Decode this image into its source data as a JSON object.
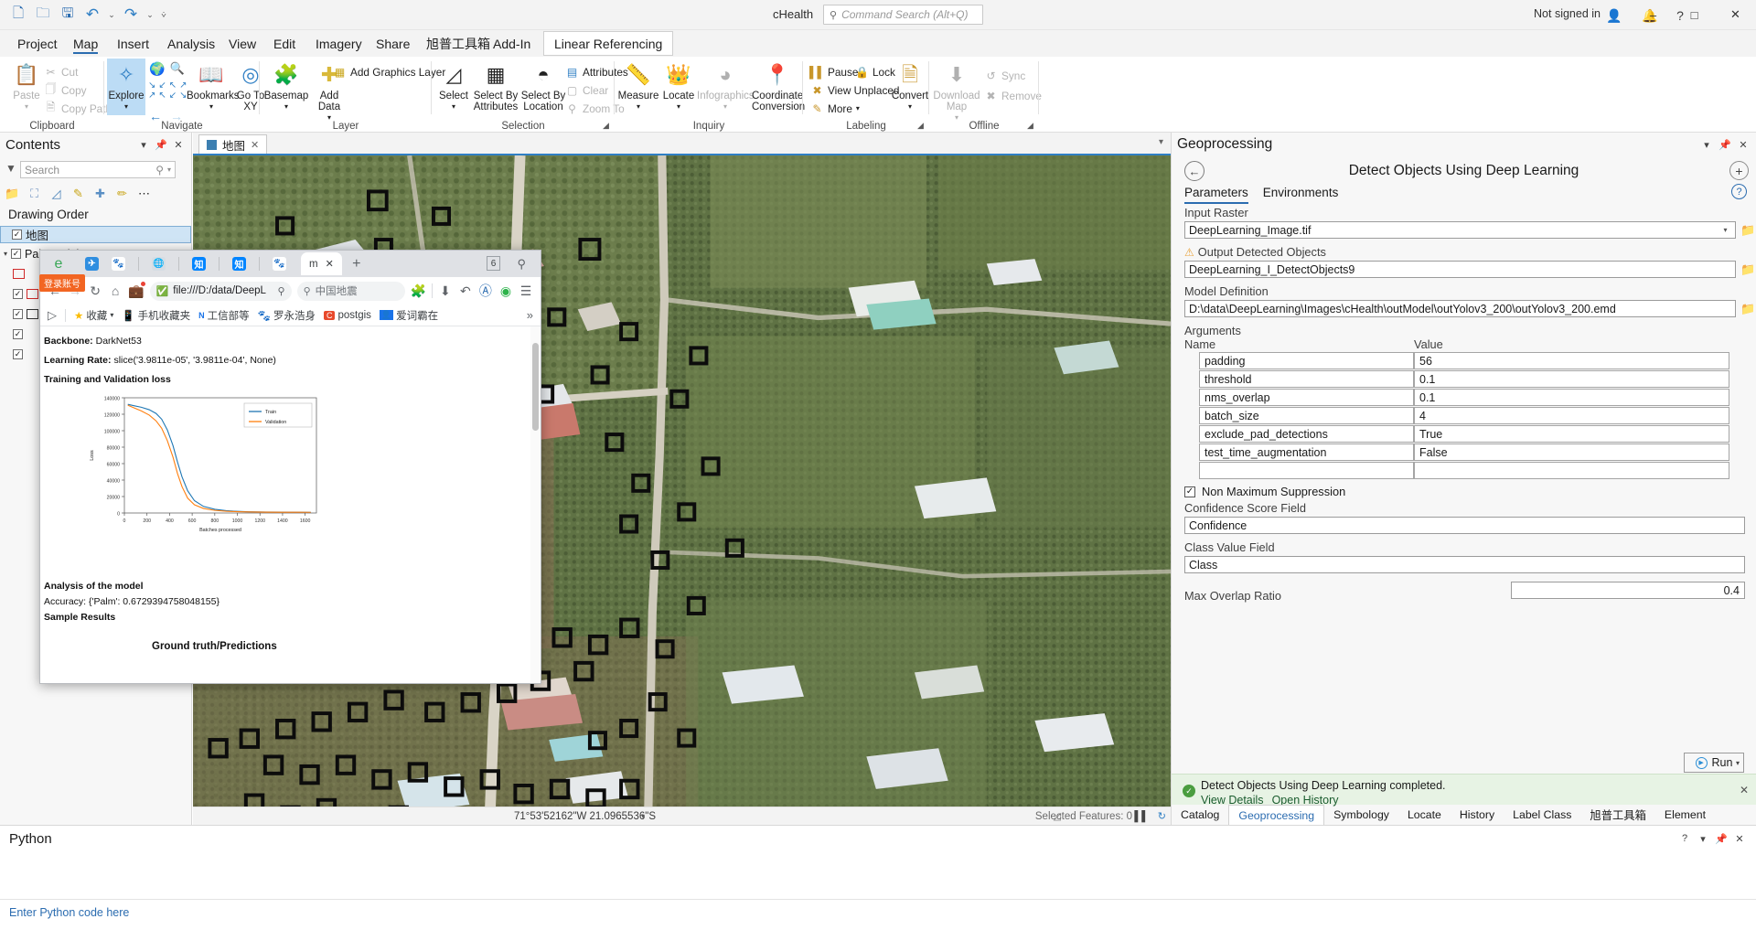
{
  "titlebar": {
    "project_name": "cHealth",
    "search_placeholder": "Command Search (Alt+Q)",
    "signin": "Not signed in",
    "quick_access": [
      "new-project-icon",
      "open-project-icon",
      "save-project-icon",
      "undo-icon",
      "redo-icon",
      "customize-qat-icon"
    ],
    "window_buttons": [
      "minimize",
      "restore",
      "close"
    ]
  },
  "ribbon": {
    "tabs": [
      {
        "label": "Project",
        "active": false
      },
      {
        "label": "Map",
        "active": true
      },
      {
        "label": "Insert",
        "active": false
      },
      {
        "label": "Analysis",
        "active": false
      },
      {
        "label": "View",
        "active": false
      },
      {
        "label": "Edit",
        "active": false
      },
      {
        "label": "Imagery",
        "active": false
      },
      {
        "label": "Share",
        "active": false
      },
      {
        "label": "旭普工具箱",
        "active": false
      },
      {
        "label": "Add-In",
        "active": false
      },
      {
        "label": "Linear Referencing",
        "active": false,
        "boxed": true
      }
    ],
    "groups": [
      {
        "name": "Clipboard"
      },
      {
        "name": "Navigate"
      },
      {
        "name": "Layer"
      },
      {
        "name": "Selection"
      },
      {
        "name": "Inquiry"
      },
      {
        "name": "Labeling"
      },
      {
        "name": "Offline"
      }
    ],
    "clipboard": {
      "paste": "Paste",
      "cut": "Cut",
      "copy": "Copy",
      "copy_path": "Copy Path"
    },
    "navigate": {
      "explore": "Explore",
      "bookmarks": "Bookmarks",
      "goto": "Go To XY"
    },
    "layer": {
      "basemap": "Basemap",
      "add_data": "Add Data",
      "add_graphics": "Add Graphics Layer"
    },
    "selection": {
      "select": "Select",
      "select_attr": "Select By Attributes",
      "select_loc": "Select By Location",
      "attributes": "Attributes",
      "clear": "Clear",
      "zoom_to": "Zoom To"
    },
    "inquiry": {
      "measure": "Measure",
      "locate": "Locate",
      "infographics": "Infographics",
      "coordinate": "Coordinate Conversion"
    },
    "labeling": {
      "pause": "Pause",
      "lock": "Lock",
      "view_unplaced": "View Unplaced",
      "more": "More",
      "convert": "Convert"
    },
    "offline": {
      "download_map": "Download Map",
      "sync": "Sync",
      "remove": "Remove"
    }
  },
  "contents": {
    "title": "Contents",
    "search_placeholder": "Search",
    "drawing_order": "Drawing Order",
    "layers": [
      {
        "label": "地图",
        "type": "map",
        "checked": true,
        "selected": true
      },
      {
        "label": "PalmTraining",
        "type": "group",
        "checked": true,
        "selected": false
      }
    ]
  },
  "map": {
    "tab_label": "地图",
    "tab_sublabel": "m",
    "coordinates": "71°53'52162\"W 21.0965536\"S",
    "selected_features": "Selected Features: 0"
  },
  "browser": {
    "tab_label": "m",
    "tab_count": "6",
    "url": "file:///D:/data/DeepL",
    "search_placeholder": "中国地震",
    "login_badge": "登录账号",
    "bookmarks": [
      "收藏",
      "手机收藏夹",
      "工信部等",
      "罗永浩身",
      "postgis",
      "爱词霸在"
    ],
    "page": {
      "backbone_label": "Backbone:",
      "backbone_value": "DarkNet53",
      "lr_label": "Learning Rate:",
      "lr_value": "slice('3.9811e-05', '3.9811e-04', None)",
      "loss_heading": "Training and Validation loss",
      "analysis_heading": "Analysis of the model",
      "accuracy": "Accuracy: {'Palm': 0.6729394758048155}",
      "sample_heading": "Sample Results",
      "gt_heading": "Ground truth/Predictions"
    }
  },
  "chart_data": {
    "type": "line",
    "title": "Training and Validation loss",
    "xlabel": "Batches processed",
    "ylabel": "Loss",
    "xlim": [
      0,
      1700
    ],
    "ylim": [
      0,
      140000
    ],
    "xticks": [
      0,
      200,
      400,
      600,
      800,
      1000,
      1200,
      1400,
      1600
    ],
    "yticks": [
      0,
      20000,
      40000,
      60000,
      80000,
      100000,
      120000,
      140000
    ],
    "ytick_labels": [
      "0",
      "20000",
      "40000",
      "60000",
      "80000",
      "100000",
      "120000",
      "140000"
    ],
    "legend": [
      "Train",
      "Validation"
    ],
    "legend_position": "upper right",
    "grid": false,
    "series": [
      {
        "name": "Train",
        "color": "#1f77b4",
        "x": [
          30,
          80,
          150,
          220,
          280,
          330,
          380,
          430,
          470,
          510,
          560,
          620,
          700,
          800,
          900,
          1000,
          1100,
          1250,
          1400,
          1550,
          1650
        ],
        "y": [
          132000,
          130500,
          128500,
          125500,
          121000,
          114000,
          101000,
          82000,
          62000,
          44000,
          27000,
          15000,
          8000,
          4500,
          2800,
          2000,
          1500,
          1200,
          1000,
          900,
          850
        ]
      },
      {
        "name": "Validation",
        "color": "#ff7f0e",
        "x": [
          30,
          80,
          150,
          220,
          280,
          330,
          380,
          430,
          470,
          510,
          560,
          620,
          700,
          800,
          900,
          1000,
          1100,
          1250,
          1400,
          1550,
          1650
        ],
        "y": [
          131000,
          128000,
          124000,
          119000,
          112000,
          103000,
          88000,
          68000,
          48000,
          32000,
          18000,
          10000,
          5500,
          3200,
          2100,
          1600,
          1300,
          1050,
          950,
          880,
          830
        ]
      }
    ]
  },
  "geoprocessing": {
    "title": "Geoprocessing",
    "tool_name": "Detect Objects Using Deep Learning",
    "tabs": [
      {
        "label": "Parameters",
        "active": true
      },
      {
        "label": "Environments",
        "active": false
      }
    ],
    "input_raster_label": "Input Raster",
    "input_raster_value": "DeepLearning_Image.tif",
    "output_label": "Output Detected Objects",
    "output_value": "DeepLearning_I_DetectObjects9",
    "output_warning": true,
    "model_label": "Model Definition",
    "model_value": "D:\\data\\DeepLearning\\Images\\cHealth\\outModel\\outYolov3_200\\outYolov3_200.emd",
    "arguments_label": "Arguments",
    "col_name": "Name",
    "col_value": "Value",
    "arguments": [
      {
        "name": "padding",
        "value": "56"
      },
      {
        "name": "threshold",
        "value": "0.1"
      },
      {
        "name": "nms_overlap",
        "value": "0.1"
      },
      {
        "name": "batch_size",
        "value": "4"
      },
      {
        "name": "exclude_pad_detections",
        "value": "True"
      },
      {
        "name": "test_time_augmentation",
        "value": "False"
      },
      {
        "name": "",
        "value": ""
      }
    ],
    "nms_label": "Non Maximum Suppression",
    "nms_checked": true,
    "confidence_label": "Confidence Score Field",
    "confidence_value": "Confidence",
    "class_label": "Class Value Field",
    "class_value": "Class",
    "max_overlap_label": "Max Overlap Ratio",
    "max_overlap_value": "0.4",
    "run_label": "Run",
    "message": "Detect Objects Using Deep Learning completed.",
    "message_links": [
      "View Details",
      "Open History"
    ],
    "dock_tabs": [
      {
        "label": "Catalog",
        "active": false
      },
      {
        "label": "Geoprocessing",
        "active": true
      },
      {
        "label": "Symbology",
        "active": false
      },
      {
        "label": "Locate",
        "active": false
      },
      {
        "label": "History",
        "active": false
      },
      {
        "label": "Label Class",
        "active": false
      },
      {
        "label": "旭普工具箱",
        "active": false
      },
      {
        "label": "Element",
        "active": false
      }
    ]
  },
  "python": {
    "title": "Python",
    "prompt": "Enter Python code here"
  },
  "colors": {
    "accent": "#2b6cb0",
    "detection_box": "#111111",
    "selection": "#ff0000",
    "success_bg": "#e7f3e4"
  }
}
